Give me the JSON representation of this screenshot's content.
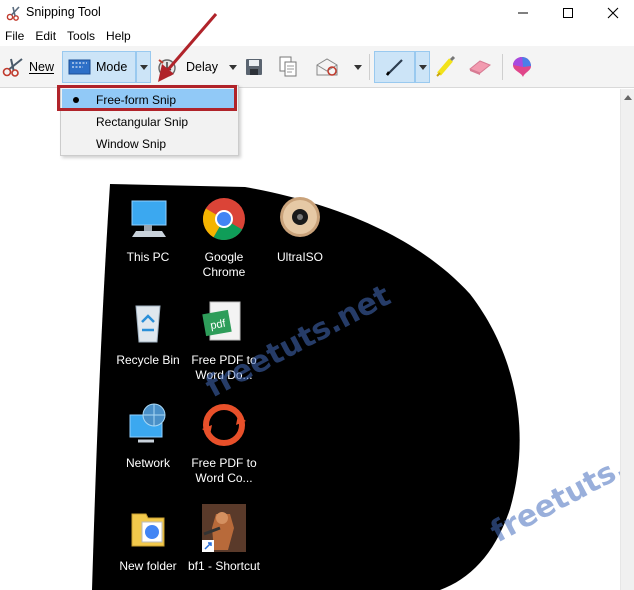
{
  "window": {
    "title": "Snipping Tool",
    "controls": [
      "minimize",
      "maximize",
      "close"
    ]
  },
  "menubar": {
    "items": [
      "File",
      "Edit",
      "Tools",
      "Help"
    ]
  },
  "toolbar": {
    "new_label": "New",
    "mode_label": "Mode",
    "delay_label": "Delay"
  },
  "mode_menu": {
    "items": [
      {
        "label": "Free-form Snip",
        "selected": true
      },
      {
        "label": "Rectangular Snip",
        "selected": false
      },
      {
        "label": "Window Snip",
        "selected": false
      }
    ]
  },
  "desktop_icons": [
    {
      "label": "This PC",
      "icon": "this-pc-icon"
    },
    {
      "label": "Google Chrome",
      "icon": "chrome-icon"
    },
    {
      "label": "UltraISO",
      "icon": "ultraiso-icon"
    },
    {
      "label": "Recycle Bin",
      "icon": "recycle-bin-icon"
    },
    {
      "label": "Free PDF to Word Do...",
      "icon": "pdf-icon"
    },
    {
      "label": "Network",
      "icon": "network-icon"
    },
    {
      "label": "Free PDF to Word Co...",
      "icon": "pdf-converter-icon"
    },
    {
      "label": "New folder",
      "icon": "folder-icon"
    },
    {
      "label": "bf1 - Shortcut",
      "icon": "game-shortcut-icon"
    }
  ],
  "watermarks": [
    "freetuts.net",
    "freetuts.ne"
  ],
  "colors": {
    "accent": "#cce4f7",
    "selected_item": "#91c9f7",
    "highlight_border": "#b0232a",
    "snip_background": "#000000"
  }
}
